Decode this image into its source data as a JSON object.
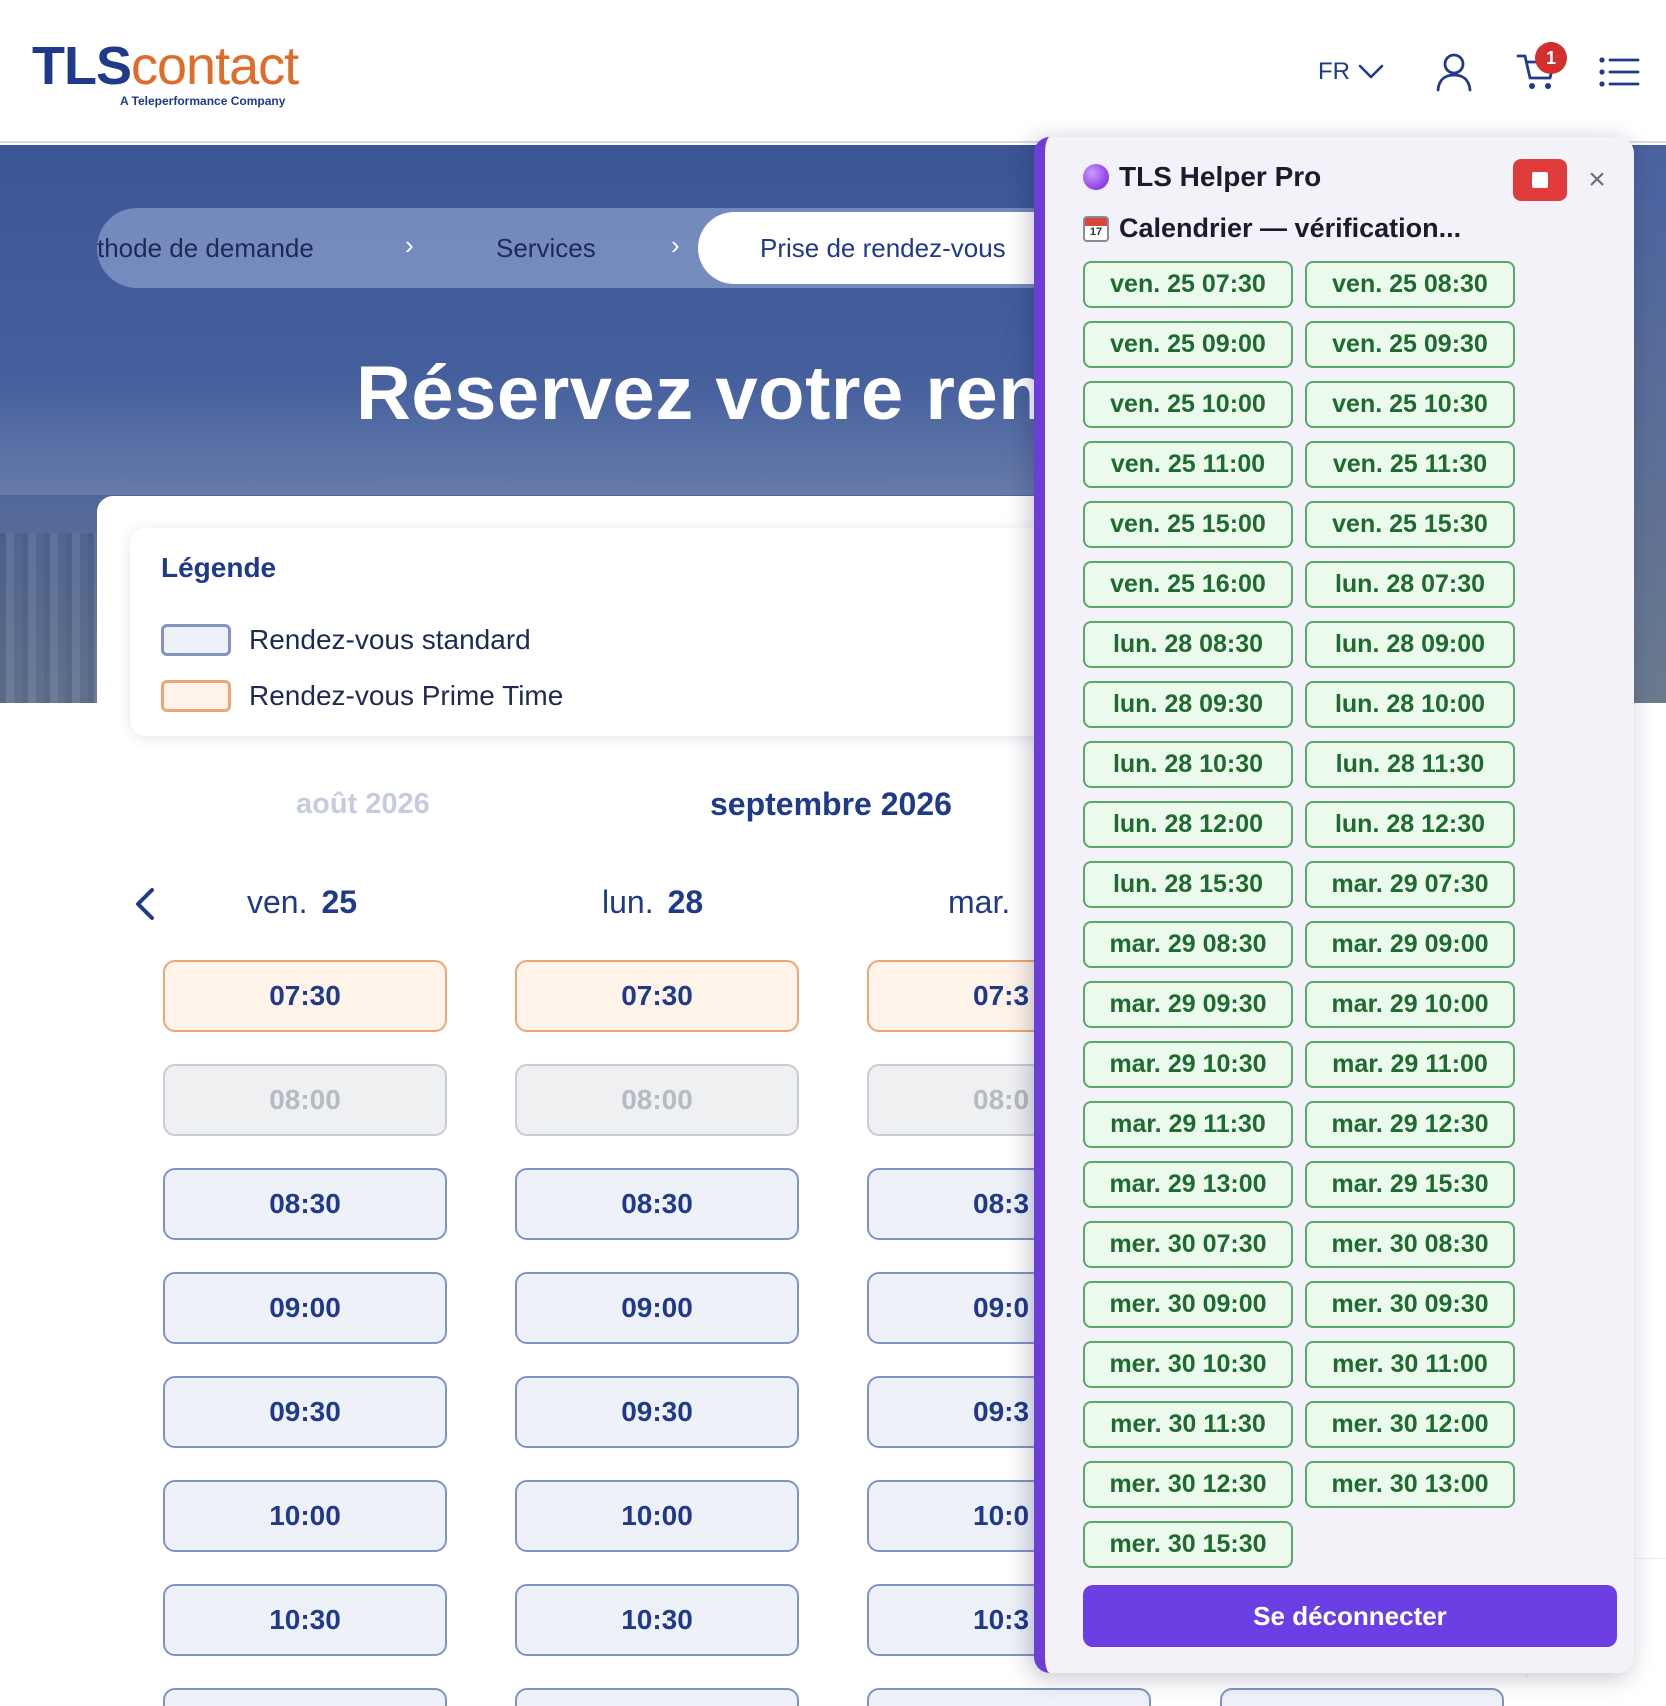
{
  "header": {
    "logo_tls": "TLS",
    "logo_contact": "contact",
    "logo_sub": "A Teleperformance Company",
    "lang": "FR",
    "cart_count": "1"
  },
  "steps": {
    "step1": "thode de demande",
    "step2": "Services",
    "step3": "Prise de rendez-vous"
  },
  "hero": {
    "title": "Réservez votre rend"
  },
  "legend": {
    "title": "Légende",
    "standard": "Rendez-vous standard",
    "prime": "Rendez-vous Prime Time"
  },
  "calendar": {
    "month_prev": "août 2026",
    "month_current": "septembre 2026",
    "days": [
      {
        "name": "ven.",
        "num": "25"
      },
      {
        "name": "lun.",
        "num": "28"
      },
      {
        "name": "mar.",
        "num": ""
      }
    ],
    "col1_slots": [
      "07:30",
      "08:00",
      "08:30",
      "09:00",
      "09:30",
      "10:00",
      "10:30"
    ],
    "col2_slots": [
      "07:30",
      "08:00",
      "08:30",
      "09:00",
      "09:30",
      "10:00",
      "10:30"
    ],
    "col3_slots": [
      "07:3",
      "08:0",
      "08:3",
      "09:0",
      "09:3",
      "10:0",
      "10:3"
    ]
  },
  "helper": {
    "title": "TLS Helper Pro",
    "close": "×",
    "status": "Calendrier — vérification...",
    "slots": [
      "ven. 25 07:30",
      "ven. 25 08:30",
      "ven. 25 09:00",
      "ven. 25 09:30",
      "ven. 25 10:00",
      "ven. 25 10:30",
      "ven. 25 11:00",
      "ven. 25 11:30",
      "ven. 25 15:00",
      "ven. 25 15:30",
      "ven. 25 16:00",
      "lun. 28 07:30",
      "lun. 28 08:30",
      "lun. 28 09:00",
      "lun. 28 09:30",
      "lun. 28 10:00",
      "lun. 28 10:30",
      "lun. 28 11:30",
      "lun. 28 12:00",
      "lun. 28 12:30",
      "lun. 28 15:30",
      "mar. 29 07:30",
      "mar. 29 08:30",
      "mar. 29 09:00",
      "mar. 29 09:30",
      "mar. 29 10:00",
      "mar. 29 10:30",
      "mar. 29 11:00",
      "mar. 29 11:30",
      "mar. 29 12:30",
      "mar. 29 13:00",
      "mar. 29 15:30",
      "mer. 30 07:30",
      "mer. 30 08:30",
      "mer. 30 09:00",
      "mer. 30 09:30",
      "mer. 30 10:30",
      "mer. 30 11:00",
      "mer. 30 11:30",
      "mer. 30 12:00",
      "mer. 30 12:30",
      "mer. 30 13:00",
      "mer. 30 15:30"
    ],
    "logout": "Se déconnecter"
  },
  "colors": {
    "brand_blue": "#1f3a8a",
    "brand_orange": "#e06c2a",
    "helper_purple": "#6b3fe3",
    "chip_green": "#58a86a",
    "stop_red": "#e03c3c"
  }
}
